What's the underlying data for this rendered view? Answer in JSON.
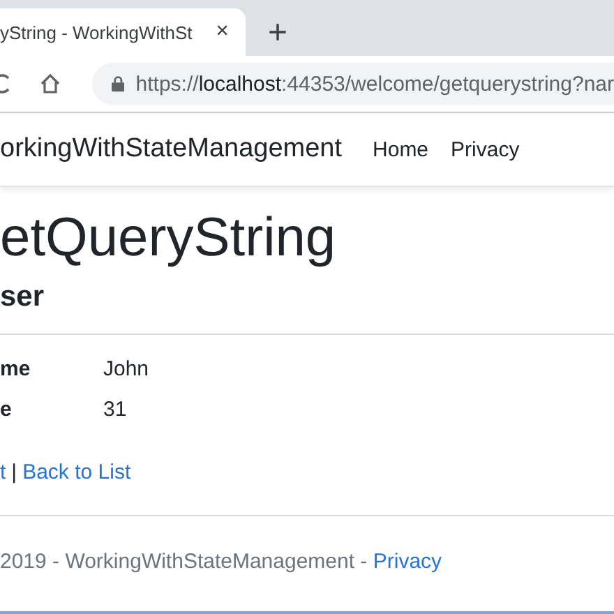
{
  "browser": {
    "tab": {
      "title": "yString - WorkingWithSt",
      "close": "×",
      "selected": true
    },
    "new_tab": "+",
    "url": {
      "scheme": "https://",
      "host": "localhost",
      "rest": ":44353/welcome/getquerystring?nar"
    }
  },
  "navbar": {
    "brand": "orkingWithStateManagement",
    "links": [
      "Home",
      "Privacy"
    ]
  },
  "page": {
    "title": "etQueryString",
    "subtitle": "ser",
    "fields": [
      {
        "label": "me",
        "value": "John"
      },
      {
        "label": "e",
        "value": "31"
      }
    ],
    "actions": {
      "links": [
        "t",
        "Back to List"
      ],
      "separator": "|"
    }
  },
  "footer": {
    "text": "2019 - WorkingWithStateManagement - ",
    "link": "Privacy"
  }
}
